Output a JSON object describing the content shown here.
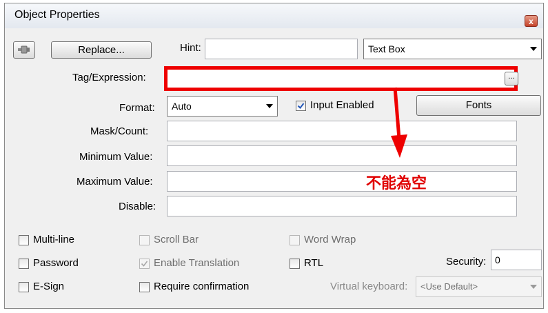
{
  "window": {
    "title": "Object Properties",
    "close_label": "x"
  },
  "toolbar": {
    "pin_icon": "pushpin-icon",
    "replace_label": "Replace...",
    "hint_label": "Hint:",
    "hint_value": "",
    "type_value": "Text Box"
  },
  "fields": {
    "tag_label": "Tag/Expression:",
    "tag_value": "",
    "browse_label": "...",
    "format_label": "Format:",
    "format_value": "Auto",
    "input_enabled_label": "Input Enabled",
    "input_enabled_checked": true,
    "fonts_label": "Fonts",
    "mask_label": "Mask/Count:",
    "mask_value": "",
    "min_label": "Minimum Value:",
    "min_value": "",
    "max_label": "Maximum Value:",
    "max_value": "",
    "disable_label": "Disable:",
    "disable_value": ""
  },
  "options": {
    "multiline": "Multi-line",
    "scrollbar": "Scroll Bar",
    "wordwrap": "Word Wrap",
    "password": "Password",
    "enable_translation": "Enable Translation",
    "rtl": "RTL",
    "security_label": "Security:",
    "security_value": "0",
    "esign": "E-Sign",
    "require_confirmation": "Require confirmation",
    "virtual_keyboard_label": "Virtual keyboard:",
    "virtual_keyboard_value": "<Use Default>"
  },
  "annotation": {
    "text": "不能為空",
    "color": "#ee0000"
  }
}
